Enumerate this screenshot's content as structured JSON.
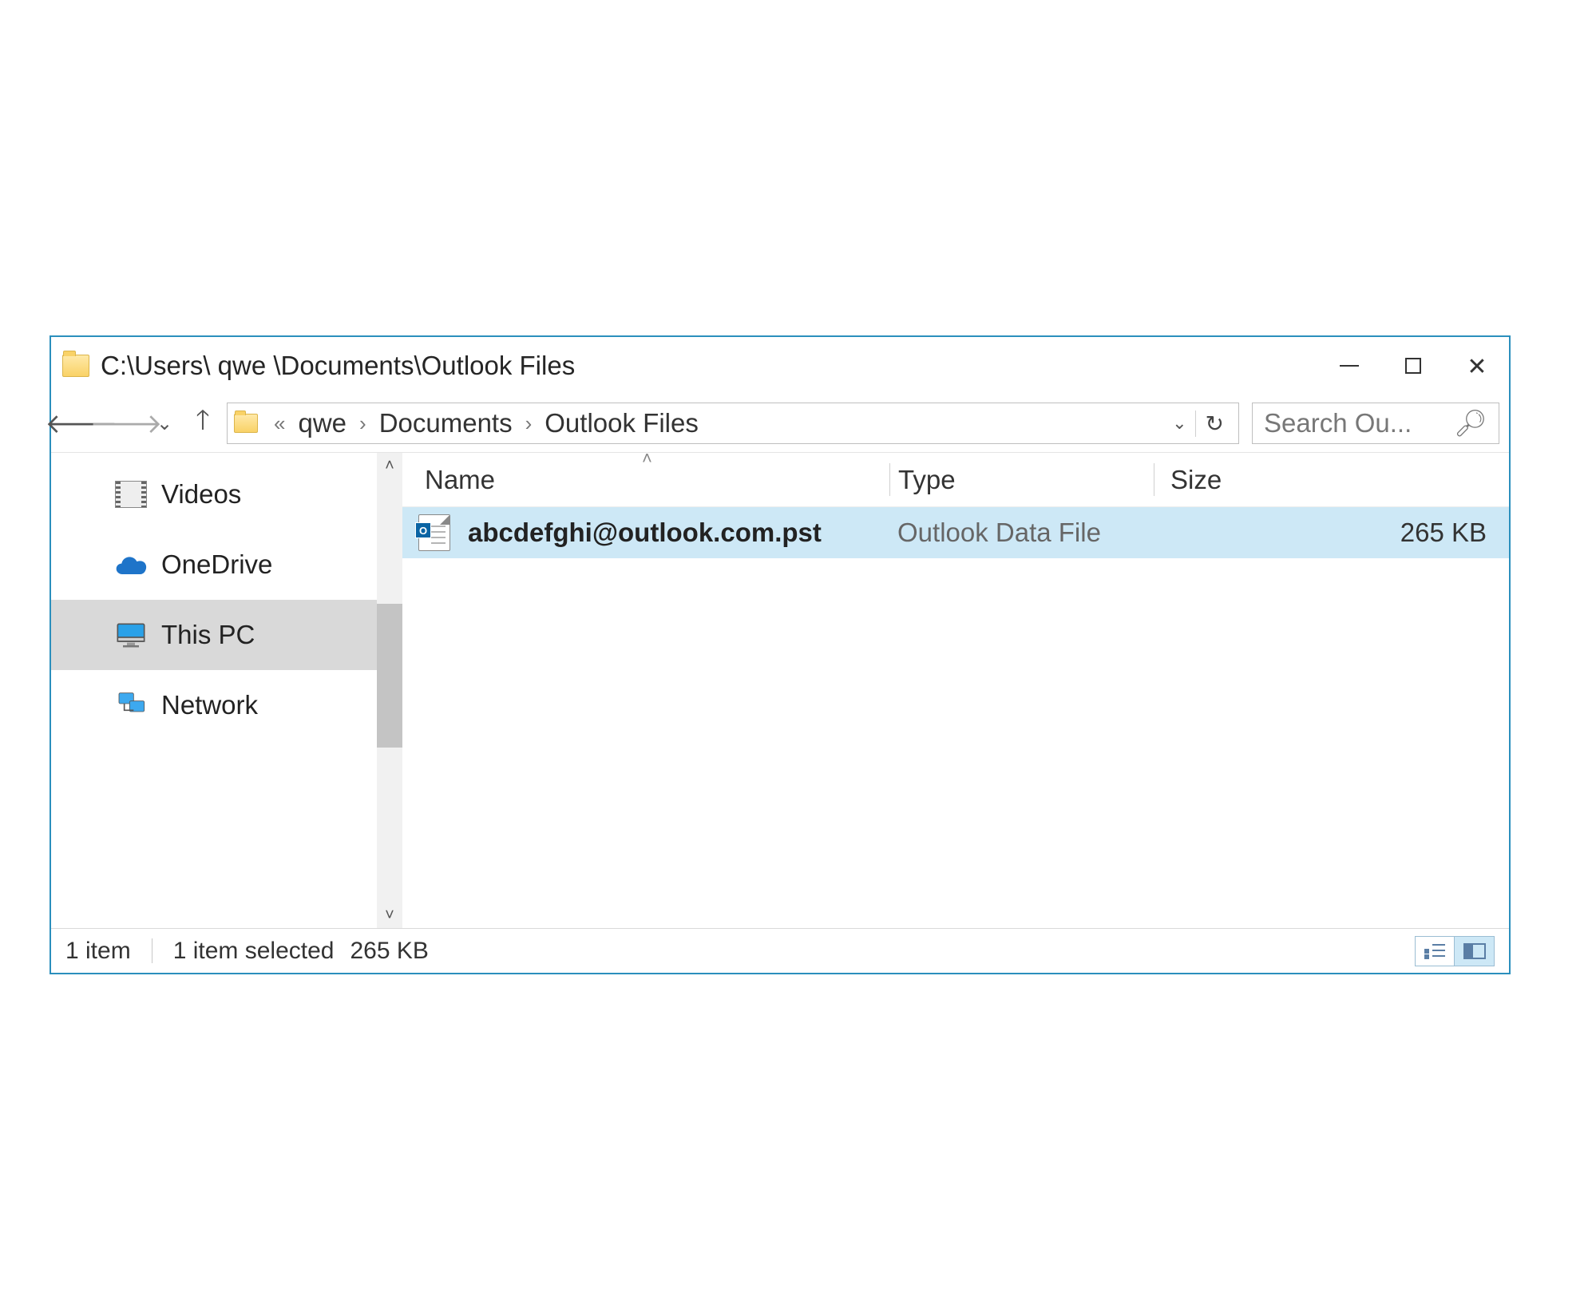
{
  "window": {
    "title": "C:\\Users\\ qwe \\Documents\\Outlook Files"
  },
  "breadcrumb": {
    "overflow_glyph": "«",
    "segments": [
      "qwe",
      "Documents",
      "Outlook Files"
    ]
  },
  "search": {
    "placeholder": "Search Ou..."
  },
  "sidebar": {
    "items": [
      {
        "label": "Videos",
        "icon": "videos-icon",
        "selected": false
      },
      {
        "label": "OneDrive",
        "icon": "onedrive-icon",
        "selected": false
      },
      {
        "label": "This PC",
        "icon": "thispc-icon",
        "selected": true
      },
      {
        "label": "Network",
        "icon": "network-icon",
        "selected": false
      }
    ]
  },
  "columns": {
    "name": "Name",
    "type": "Type",
    "size": "Size",
    "sort": {
      "column": "name",
      "direction": "asc"
    }
  },
  "files": [
    {
      "name": "abcdefghi@outlook.com.pst",
      "type": "Outlook Data File",
      "size": "265 KB",
      "icon": "outlook-pst-icon",
      "selected": true
    }
  ],
  "status": {
    "item_count": "1 item",
    "selection": "1 item selected",
    "selection_size": "265 KB",
    "active_view": "large"
  }
}
